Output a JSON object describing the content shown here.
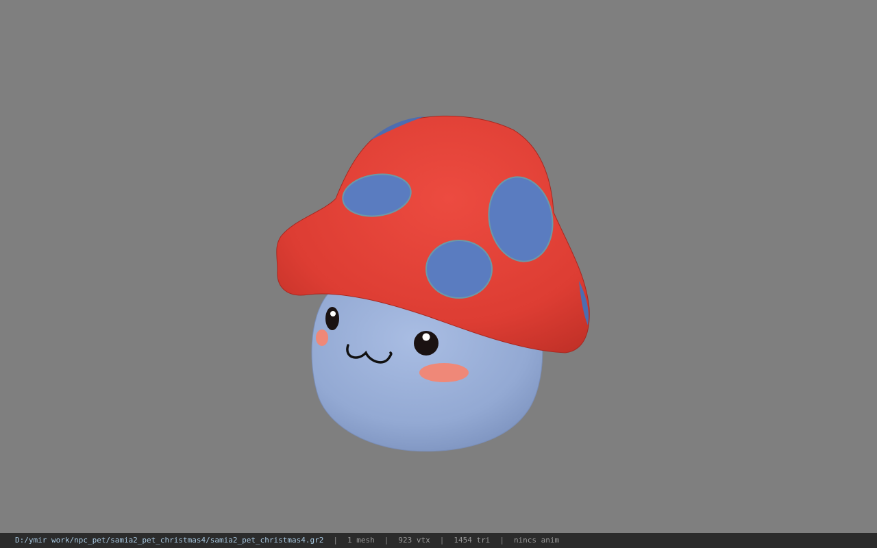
{
  "colors": {
    "background": "#7f7f7f",
    "cap_red": "#e0443a",
    "cap_spots": "#5a7cc0",
    "body_blue": "#9ab0d8",
    "cheeks": "#ef8878",
    "statusbar_bg": "#2b2b2b"
  },
  "status": {
    "path": "D:/ymir work/npc_pet/samia2_pet_christmas4/samia2_pet_christmas4.gr2",
    "sep": "|",
    "mesh": "1 mesh",
    "vtx": "923 vtx",
    "tri": "1454 tri",
    "anim": "nincs anim"
  }
}
